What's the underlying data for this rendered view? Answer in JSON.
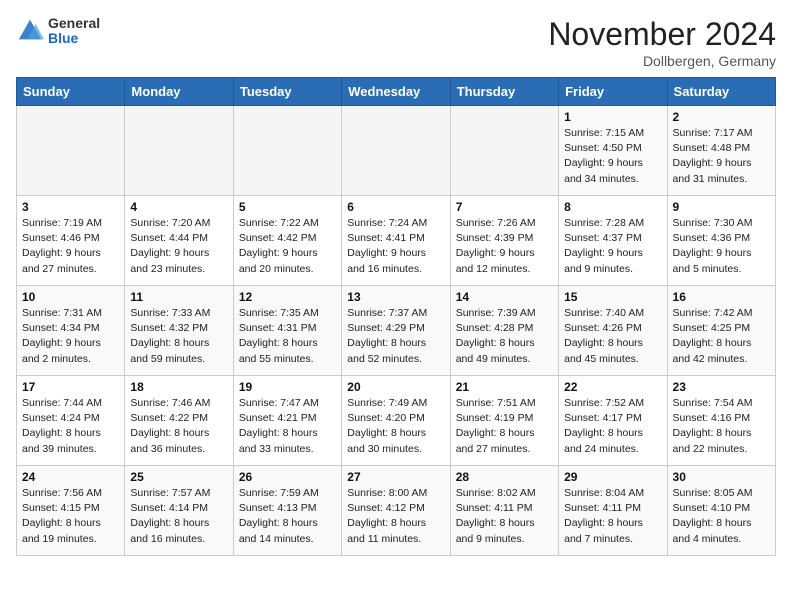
{
  "header": {
    "logo_general": "General",
    "logo_blue": "Blue",
    "month_title": "November 2024",
    "location": "Dollbergen, Germany"
  },
  "columns": [
    "Sunday",
    "Monday",
    "Tuesday",
    "Wednesday",
    "Thursday",
    "Friday",
    "Saturday"
  ],
  "weeks": [
    [
      {
        "day": "",
        "info": ""
      },
      {
        "day": "",
        "info": ""
      },
      {
        "day": "",
        "info": ""
      },
      {
        "day": "",
        "info": ""
      },
      {
        "day": "",
        "info": ""
      },
      {
        "day": "1",
        "info": "Sunrise: 7:15 AM\nSunset: 4:50 PM\nDaylight: 9 hours and 34 minutes."
      },
      {
        "day": "2",
        "info": "Sunrise: 7:17 AM\nSunset: 4:48 PM\nDaylight: 9 hours and 31 minutes."
      }
    ],
    [
      {
        "day": "3",
        "info": "Sunrise: 7:19 AM\nSunset: 4:46 PM\nDaylight: 9 hours and 27 minutes."
      },
      {
        "day": "4",
        "info": "Sunrise: 7:20 AM\nSunset: 4:44 PM\nDaylight: 9 hours and 23 minutes."
      },
      {
        "day": "5",
        "info": "Sunrise: 7:22 AM\nSunset: 4:42 PM\nDaylight: 9 hours and 20 minutes."
      },
      {
        "day": "6",
        "info": "Sunrise: 7:24 AM\nSunset: 4:41 PM\nDaylight: 9 hours and 16 minutes."
      },
      {
        "day": "7",
        "info": "Sunrise: 7:26 AM\nSunset: 4:39 PM\nDaylight: 9 hours and 12 minutes."
      },
      {
        "day": "8",
        "info": "Sunrise: 7:28 AM\nSunset: 4:37 PM\nDaylight: 9 hours and 9 minutes."
      },
      {
        "day": "9",
        "info": "Sunrise: 7:30 AM\nSunset: 4:36 PM\nDaylight: 9 hours and 5 minutes."
      }
    ],
    [
      {
        "day": "10",
        "info": "Sunrise: 7:31 AM\nSunset: 4:34 PM\nDaylight: 9 hours and 2 minutes."
      },
      {
        "day": "11",
        "info": "Sunrise: 7:33 AM\nSunset: 4:32 PM\nDaylight: 8 hours and 59 minutes."
      },
      {
        "day": "12",
        "info": "Sunrise: 7:35 AM\nSunset: 4:31 PM\nDaylight: 8 hours and 55 minutes."
      },
      {
        "day": "13",
        "info": "Sunrise: 7:37 AM\nSunset: 4:29 PM\nDaylight: 8 hours and 52 minutes."
      },
      {
        "day": "14",
        "info": "Sunrise: 7:39 AM\nSunset: 4:28 PM\nDaylight: 8 hours and 49 minutes."
      },
      {
        "day": "15",
        "info": "Sunrise: 7:40 AM\nSunset: 4:26 PM\nDaylight: 8 hours and 45 minutes."
      },
      {
        "day": "16",
        "info": "Sunrise: 7:42 AM\nSunset: 4:25 PM\nDaylight: 8 hours and 42 minutes."
      }
    ],
    [
      {
        "day": "17",
        "info": "Sunrise: 7:44 AM\nSunset: 4:24 PM\nDaylight: 8 hours and 39 minutes."
      },
      {
        "day": "18",
        "info": "Sunrise: 7:46 AM\nSunset: 4:22 PM\nDaylight: 8 hours and 36 minutes."
      },
      {
        "day": "19",
        "info": "Sunrise: 7:47 AM\nSunset: 4:21 PM\nDaylight: 8 hours and 33 minutes."
      },
      {
        "day": "20",
        "info": "Sunrise: 7:49 AM\nSunset: 4:20 PM\nDaylight: 8 hours and 30 minutes."
      },
      {
        "day": "21",
        "info": "Sunrise: 7:51 AM\nSunset: 4:19 PM\nDaylight: 8 hours and 27 minutes."
      },
      {
        "day": "22",
        "info": "Sunrise: 7:52 AM\nSunset: 4:17 PM\nDaylight: 8 hours and 24 minutes."
      },
      {
        "day": "23",
        "info": "Sunrise: 7:54 AM\nSunset: 4:16 PM\nDaylight: 8 hours and 22 minutes."
      }
    ],
    [
      {
        "day": "24",
        "info": "Sunrise: 7:56 AM\nSunset: 4:15 PM\nDaylight: 8 hours and 19 minutes."
      },
      {
        "day": "25",
        "info": "Sunrise: 7:57 AM\nSunset: 4:14 PM\nDaylight: 8 hours and 16 minutes."
      },
      {
        "day": "26",
        "info": "Sunrise: 7:59 AM\nSunset: 4:13 PM\nDaylight: 8 hours and 14 minutes."
      },
      {
        "day": "27",
        "info": "Sunrise: 8:00 AM\nSunset: 4:12 PM\nDaylight: 8 hours and 11 minutes."
      },
      {
        "day": "28",
        "info": "Sunrise: 8:02 AM\nSunset: 4:11 PM\nDaylight: 8 hours and 9 minutes."
      },
      {
        "day": "29",
        "info": "Sunrise: 8:04 AM\nSunset: 4:11 PM\nDaylight: 8 hours and 7 minutes."
      },
      {
        "day": "30",
        "info": "Sunrise: 8:05 AM\nSunset: 4:10 PM\nDaylight: 8 hours and 4 minutes."
      }
    ]
  ]
}
